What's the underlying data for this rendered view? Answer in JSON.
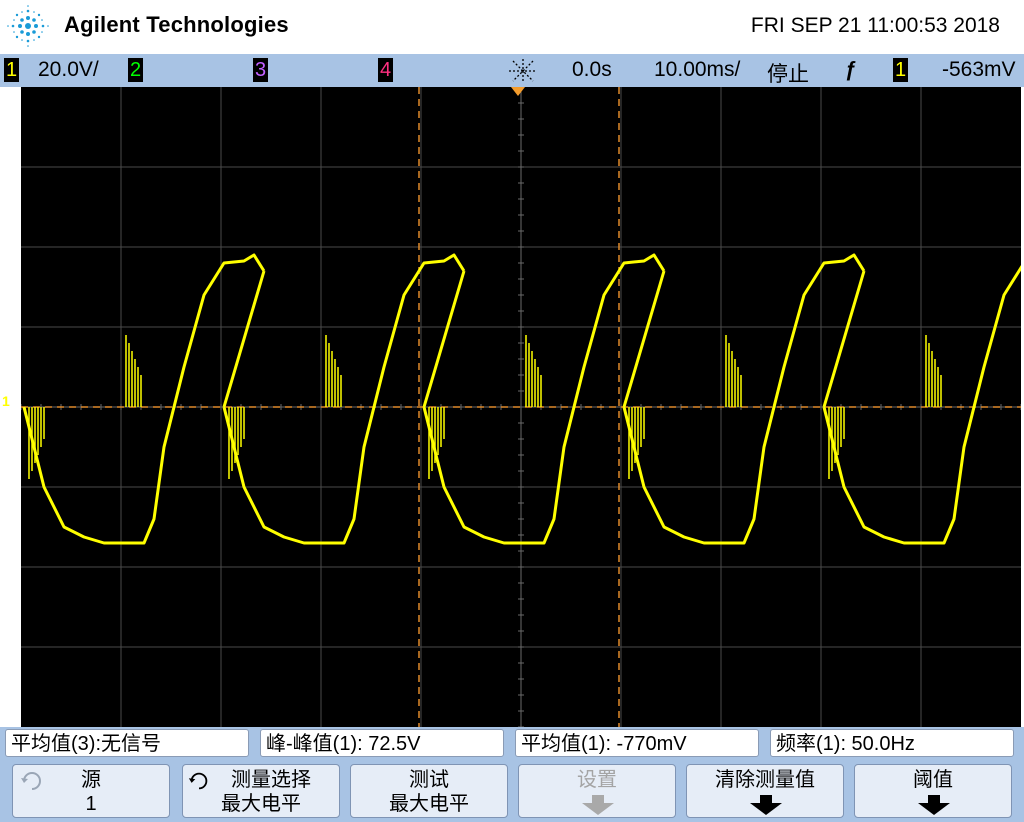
{
  "header": {
    "brand": "Agilent Technologies",
    "datetime": "FRI SEP 21 11:00:53 2018"
  },
  "status": {
    "ch1_label": "1",
    "ch1_scale": "20.0V/",
    "ch2_label": "2",
    "ch3_label": "3",
    "ch4_label": "4",
    "time_delay": "0.0s",
    "time_scale": "10.00ms/",
    "run_state": "停止",
    "trigger_slope": "ƒ",
    "trigger_source": "1",
    "trigger_level": "-563mV",
    "colors": {
      "ch1": "#ffff00",
      "ch2": "#00ff00",
      "ch3": "#c060ff",
      "ch4": "#ff3080"
    }
  },
  "screen": {
    "ch1_marker": "1",
    "ch1_color": "#ffff00",
    "cursor_color": "#e08a2a"
  },
  "chart_data": {
    "type": "line",
    "series": [
      {
        "name": "1",
        "color": "#ffff00"
      }
    ],
    "x_unit": "s",
    "y_unit": "V",
    "xlim": [
      -0.05,
      0.05
    ],
    "ylim": [
      -80,
      80
    ],
    "x": [
      -0.0497,
      -0.0487,
      -0.0477,
      -0.0457,
      -0.0437,
      -0.0417,
      -0.0397,
      -0.0377,
      -0.0367,
      -0.0357,
      -0.0347,
      -0.0337,
      -0.0317,
      -0.0297,
      -0.0277,
      -0.0267,
      -0.0257
    ],
    "y": [
      0,
      -10,
      -20,
      -30,
      -32.5,
      -34,
      -34,
      -34,
      -28,
      -10,
      0,
      10,
      28,
      36,
      36.5,
      38,
      34
    ],
    "period_s": 0.02,
    "frequency_hz": 50.0,
    "vpp_v": 72.5,
    "mean_v": -0.77,
    "cursors_x": [
      -0.0102,
      0.0098
    ],
    "cursor_y": 0
  },
  "measurements": [
    {
      "text": "平均值(3):无信号"
    },
    {
      "text": "峰-峰值(1): 72.5V"
    },
    {
      "text": "平均值(1): -770mV"
    },
    {
      "text": "频率(1): 50.0Hz"
    }
  ],
  "softkeys": [
    {
      "l1": "源",
      "l2": "1"
    },
    {
      "l1": "测量选择",
      "l2": "最大电平"
    },
    {
      "l1": "测试",
      "l2": "最大电平"
    },
    {
      "l1": "设置",
      "l2": ""
    },
    {
      "l1": "清除测量值",
      "l2": ""
    },
    {
      "l1": "阈值",
      "l2": ""
    }
  ]
}
